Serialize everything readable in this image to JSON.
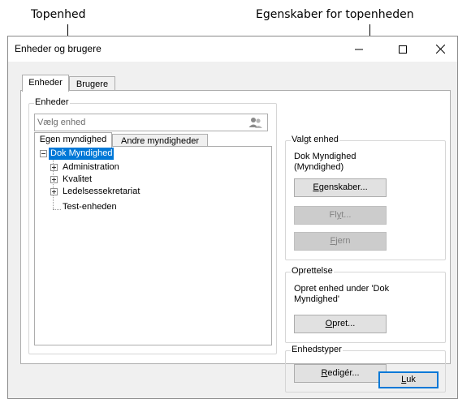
{
  "callouts": {
    "left_label": "Topenhed",
    "right_label": "Egenskaber for topenheden"
  },
  "window": {
    "title": "Enheder og brugere",
    "minimize_icon": "minimize-icon",
    "maximize_icon": "maximize-icon",
    "close_icon": "close-icon"
  },
  "tabs": [
    {
      "label": "Enheder",
      "active": true
    },
    {
      "label": "Brugere",
      "active": false
    }
  ],
  "units_group": {
    "label": "Enheder",
    "search": {
      "placeholder": "Vælg enhed",
      "icon": "users-icon"
    },
    "inner_tabs": [
      {
        "label": "Egen myndighed",
        "active": true
      },
      {
        "label": "Andre myndigheder",
        "active": false
      }
    ],
    "tree": [
      {
        "label": "Dok Myndighed",
        "level": 0,
        "expander": "minus",
        "selected": true
      },
      {
        "label": "Administration",
        "level": 1,
        "expander": "plus",
        "selected": false
      },
      {
        "label": "Kvalitet",
        "level": 1,
        "expander": "plus",
        "selected": false
      },
      {
        "label": "Ledelsessekretariat",
        "level": 1,
        "expander": "plus",
        "selected": false
      },
      {
        "label": "Test-enheden",
        "level": 1,
        "expander": "none",
        "selected": false
      }
    ]
  },
  "selected_unit": {
    "label": "Valgt enhed",
    "name": "Dok Myndighed",
    "type": "(Myndighed)",
    "properties_button": {
      "mnemonic": "E",
      "rest": "genskaber...",
      "enabled": true
    },
    "move_button": {
      "pre": "Fl",
      "mnemonic": "y",
      "rest": "t...",
      "enabled": false
    },
    "remove_button": {
      "mnemonic": "F",
      "rest": "jern",
      "enabled": false
    }
  },
  "create": {
    "label": "Oprettelse",
    "text_line1": "Opret enhed under 'Dok",
    "text_line2": "Myndighed'",
    "button": {
      "mnemonic": "O",
      "rest": "pret..."
    }
  },
  "unit_types": {
    "label": "Enhedstyper",
    "button": {
      "mnemonic": "R",
      "rest": "edigér..."
    }
  },
  "close_button": {
    "mnemonic": "L",
    "rest": "uk"
  }
}
